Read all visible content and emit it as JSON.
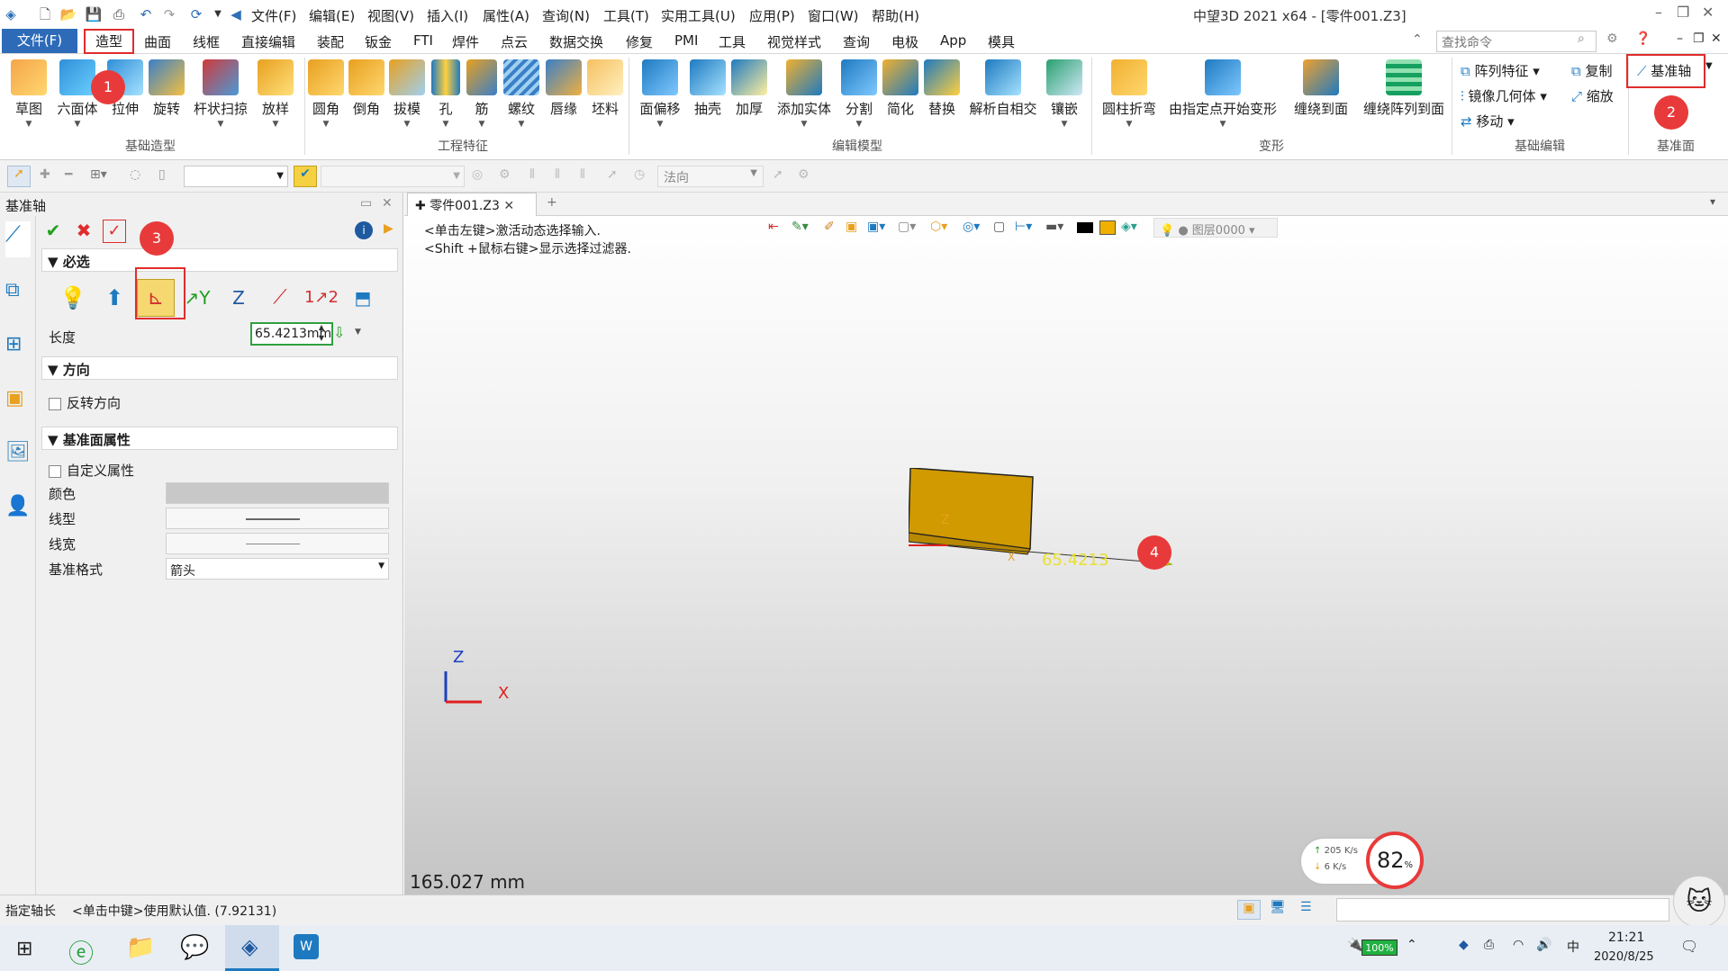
{
  "titlebar": {
    "menus": [
      "文件(F)",
      "编辑(E)",
      "视图(V)",
      "插入(I)",
      "属性(A)",
      "查询(N)",
      "工具(T)",
      "实用工具(U)",
      "应用(P)",
      "窗口(W)",
      "帮助(H)"
    ],
    "title": "中望3D 2021 x64 - [零件001.Z3]"
  },
  "tabs": {
    "file": "文件(F)",
    "items": [
      "造型",
      "曲面",
      "线框",
      "直接编辑",
      "装配",
      "钣金",
      "FTI",
      "焊件",
      "点云",
      "数据交换",
      "修复",
      "PMI",
      "工具",
      "视觉样式",
      "查询",
      "电极",
      "App",
      "模具"
    ],
    "search_placeholder": "查找命令"
  },
  "ribbon": {
    "basic": [
      "草图",
      "六面体",
      "拉伸",
      "旋转",
      "杆状扫掠",
      "放样"
    ],
    "basic_group": "基础造型",
    "eng": [
      "圆角",
      "倒角",
      "拔模",
      "孔",
      "筋",
      "螺纹",
      "唇缘",
      "坯料"
    ],
    "eng_group": "工程特征",
    "edit": [
      "面偏移",
      "抽壳",
      "加厚",
      "添加实体",
      "分割",
      "简化",
      "替换",
      "解析自相交",
      "镶嵌"
    ],
    "edit_group": "编辑模型",
    "deform": [
      "圆柱折弯",
      "由指定点开始变形",
      "缠绕到面",
      "缠绕阵列到面"
    ],
    "deform_group": "变形",
    "basic_edit": [
      "阵列特征",
      "镜像几何体",
      "移动",
      "复制",
      "缩放"
    ],
    "basic_edit_group": "基础编辑",
    "datum": "基准轴",
    "datum_group": "基准面"
  },
  "toolbar": {
    "normal_label": "法向"
  },
  "panel": {
    "title": "基准轴",
    "required": "必选",
    "length_label": "长度",
    "length_value": "65.4213mm",
    "direction": "方向",
    "reverse": "反转方向",
    "plane_props": "基准面属性",
    "custom_props": "自定义属性",
    "color": "颜色",
    "linetype": "线型",
    "linewidth": "线宽",
    "datum_style": "基准格式",
    "datum_style_value": "箭头"
  },
  "doc": {
    "tab": "零件001.Z3",
    "hint1": "<单击左键>激活动态选择输入.",
    "hint2": "<Shift +鼠标右键>显示选择过滤器.",
    "layer": "图层0000",
    "dimension": "65.4213",
    "scale": "165.027 mm",
    "axis_z": "Z",
    "axis_x": "X"
  },
  "netwidget": {
    "up": "205 K/s",
    "down": "6  K/s",
    "percent": "82",
    "unit": "%"
  },
  "status": {
    "left": "指定轴长",
    "hint": "<单击中键>使用默认值. (7.92131)"
  },
  "taskbar": {
    "battery": "100%",
    "time": "21:21",
    "date": "2020/8/25"
  },
  "badges": [
    "1",
    "2",
    "3",
    "4"
  ]
}
